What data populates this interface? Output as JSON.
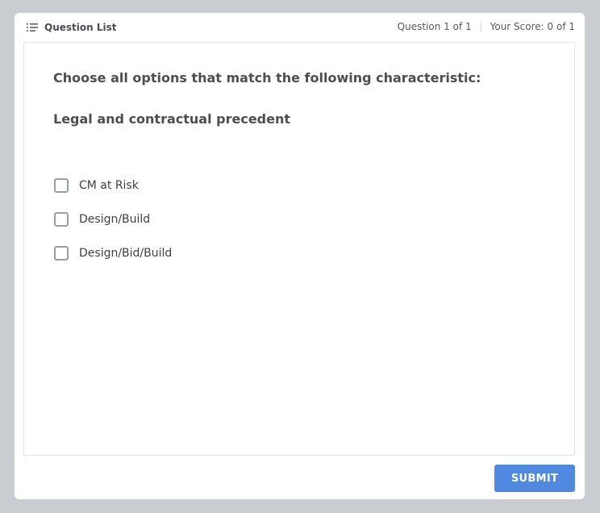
{
  "header": {
    "question_list_label": "Question List",
    "question_counter": "Question 1 of 1",
    "score": "Your Score: 0 of 1"
  },
  "question": {
    "prompt": "Choose all options that match the following characteristic:",
    "characteristic": "Legal and contractual precedent",
    "options": [
      {
        "label": "CM at Risk",
        "checked": false
      },
      {
        "label": "Design/Build",
        "checked": false
      },
      {
        "label": "Design/Bid/Build",
        "checked": false
      }
    ]
  },
  "footer": {
    "submit_label": "SUBMIT"
  },
  "colors": {
    "background": "#c9ccd1",
    "accent": "#4f8ae0"
  }
}
